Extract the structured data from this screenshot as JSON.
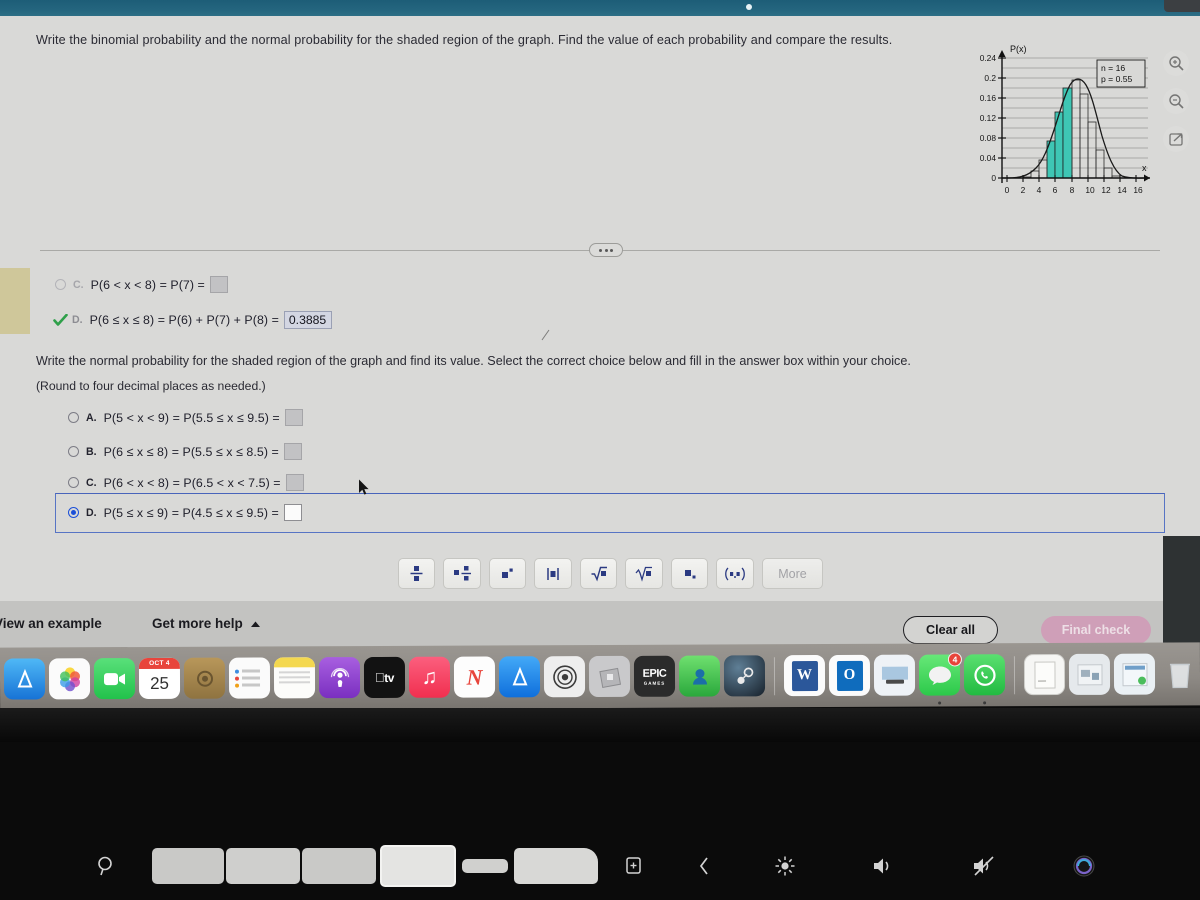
{
  "question1": {
    "stem": "Write the binomial probability and the normal probability for the shaded region of the graph. Find the value of each probability and compare the results.",
    "options": [
      {
        "letter": "C.",
        "expr": "P(6 < x < 8) = P(7) =",
        "state": "unselected",
        "answer": ""
      },
      {
        "letter": "D.",
        "expr": "P(6 ≤ x ≤ 8) = P(6) + P(7) + P(8) =",
        "state": "checked",
        "answer": "0.3885"
      }
    ]
  },
  "question2": {
    "stem": "Write the normal probability for the shaded region of the graph and find its value. Select the correct choice below and fill in the answer box within your choice.",
    "note": "(Round to four decimal places as needed.)",
    "options": [
      {
        "letter": "A.",
        "expr": "P(5 < x < 9) = P(5.5 ≤ x ≤ 9.5) =",
        "state": "unselected",
        "answer": ""
      },
      {
        "letter": "B.",
        "expr": "P(6 ≤ x ≤ 8) = P(5.5 ≤ x ≤ 8.5) =",
        "state": "unselected",
        "answer": ""
      },
      {
        "letter": "C.",
        "expr": "P(6 < x < 8) = P(6.5 < x < 7.5) =",
        "state": "unselected",
        "answer": ""
      },
      {
        "letter": "D.",
        "expr": "P(5 ≤ x ≤ 9) = P(4.5 ≤ x ≤ 9.5) =",
        "state": "selected",
        "answer": ""
      }
    ]
  },
  "chart_data": {
    "type": "bar",
    "title": "",
    "xlabel": "x",
    "ylabel": "P(x)",
    "annotation_n": "n = 16",
    "annotation_p": "p = 0.55",
    "xlim": [
      0,
      17
    ],
    "ylim": [
      0,
      0.26
    ],
    "grid": true,
    "legend": "none",
    "y_ticks": [
      "0",
      "0.04",
      "0.08",
      "0.12",
      "0.16",
      "0.2",
      "0.24"
    ],
    "y_tick_values": [
      0,
      0.04,
      0.08,
      0.12,
      0.16,
      0.2,
      0.24
    ],
    "x_ticks": [
      "0",
      "2",
      "4",
      "6",
      "8",
      "10",
      "12",
      "14",
      "16"
    ],
    "x_tick_values": [
      0,
      2,
      4,
      6,
      8,
      10,
      12,
      14,
      16
    ],
    "categories": [
      0,
      1,
      2,
      3,
      4,
      5,
      6,
      7,
      8,
      9,
      10,
      11,
      12,
      13,
      14,
      15,
      16
    ],
    "values": [
      0.0,
      0.0,
      0.001,
      0.004,
      0.014,
      0.036,
      0.074,
      0.132,
      0.181,
      0.197,
      0.168,
      0.112,
      0.057,
      0.021,
      0.005,
      0.001,
      0.0
    ],
    "shaded_categories": [
      6,
      7,
      8
    ],
    "shaded_color": "#3ec6b4",
    "curve": "normal-approximation",
    "bar_outline_color": "#2b2b2b"
  },
  "toolbar": {
    "buttons": [
      {
        "name": "fraction",
        "glyph": "fraction"
      },
      {
        "name": "mixed-fraction",
        "glyph": "mixed"
      },
      {
        "name": "exponent",
        "glyph": "exponent"
      },
      {
        "name": "absolute-value",
        "glyph": "abs"
      },
      {
        "name": "square-root",
        "glyph": "sqrt"
      },
      {
        "name": "nth-root",
        "glyph": "nthroot"
      },
      {
        "name": "subscript",
        "glyph": "subscript"
      },
      {
        "name": "interval",
        "glyph": "interval"
      }
    ],
    "more_label": "More",
    "close_label": "✕"
  },
  "footer": {
    "view_example": "View an example",
    "get_more_help": "Get more help",
    "clear_all": "Clear all",
    "final_check": "Final check"
  },
  "side_tools": [
    {
      "name": "zoom-in-icon"
    },
    {
      "name": "zoom-out-icon"
    },
    {
      "name": "pop-out-icon"
    }
  ],
  "dock": {
    "items": [
      {
        "name": "app-store",
        "label": "A",
        "color": "#1e7de0"
      },
      {
        "name": "photos",
        "label": "",
        "color": "#f6f6f6"
      },
      {
        "name": "facetime",
        "label": "",
        "color": "#39cc5d"
      },
      {
        "name": "calendar",
        "label": "25",
        "sublabel": "OCT 4",
        "color": "#ffffff"
      },
      {
        "name": "preview",
        "label": "",
        "color": "#a98a4f"
      },
      {
        "name": "reminders",
        "label": "",
        "color": "#fafafa"
      },
      {
        "name": "notes",
        "label": "",
        "color": "#f7f2d6"
      },
      {
        "name": "podcasts",
        "label": "",
        "color": "#8442c8"
      },
      {
        "name": "apple-tv",
        "label": " tv",
        "color": "#141414"
      },
      {
        "name": "music",
        "label": "♫",
        "color": "#f63b5c"
      },
      {
        "name": "news",
        "label": "N",
        "color": "#fdfdfd"
      },
      {
        "name": "mac-app-store",
        "label": "A",
        "color": "#1b8ef2"
      },
      {
        "name": "safari-tech",
        "label": "",
        "color": "#e9e9e9"
      },
      {
        "name": "roblox",
        "label": "",
        "color": "#c7c7c9"
      },
      {
        "name": "epic-games",
        "label": "EPIC GAMES",
        "color": "#2a2a2a"
      },
      {
        "name": "discord-like",
        "label": "",
        "color": "#53c74b"
      },
      {
        "name": "steam",
        "label": "",
        "color": "#2a475e"
      },
      {
        "name": "microsoft-word",
        "label": "W",
        "color": "#2b579a",
        "running": true
      },
      {
        "name": "microsoft-outlook",
        "label": "O",
        "color": "#0f6cbd",
        "running": true
      },
      {
        "name": "zoom-app",
        "label": "",
        "color": "#e9eef5",
        "running": true
      },
      {
        "name": "messages",
        "label": "",
        "color": "#4ad860",
        "badge": "4",
        "running": true
      },
      {
        "name": "whatsapp",
        "label": "",
        "color": "#3ccb5a",
        "running": true
      },
      {
        "name": "document-1",
        "label": "",
        "color": "#f3f3f1"
      },
      {
        "name": "document-2",
        "label": "",
        "color": "#e2e6ea"
      },
      {
        "name": "document-3",
        "label": "",
        "color": "#e8eef2"
      },
      {
        "name": "trash",
        "label": "",
        "color": "#dfe3e6"
      }
    ]
  },
  "touchbar": {
    "items": [
      {
        "name": "search-icon",
        "glyph": "search"
      },
      {
        "name": "app-key-1",
        "glyph": "key"
      },
      {
        "name": "app-key-2",
        "glyph": "key"
      },
      {
        "name": "app-key-3",
        "glyph": "key"
      },
      {
        "name": "app-key-active",
        "glyph": "key-active"
      },
      {
        "name": "app-key-small",
        "glyph": "key-small"
      },
      {
        "name": "app-key-wide",
        "glyph": "key-wide"
      },
      {
        "name": "screenshot-icon",
        "glyph": "screenshot"
      },
      {
        "name": "back-icon",
        "glyph": "chevron-left"
      },
      {
        "name": "brightness-icon",
        "glyph": "brightness"
      },
      {
        "name": "volume-up-icon",
        "glyph": "volume"
      },
      {
        "name": "mute-icon",
        "glyph": "mute"
      },
      {
        "name": "siri-icon",
        "glyph": "siri"
      }
    ]
  }
}
